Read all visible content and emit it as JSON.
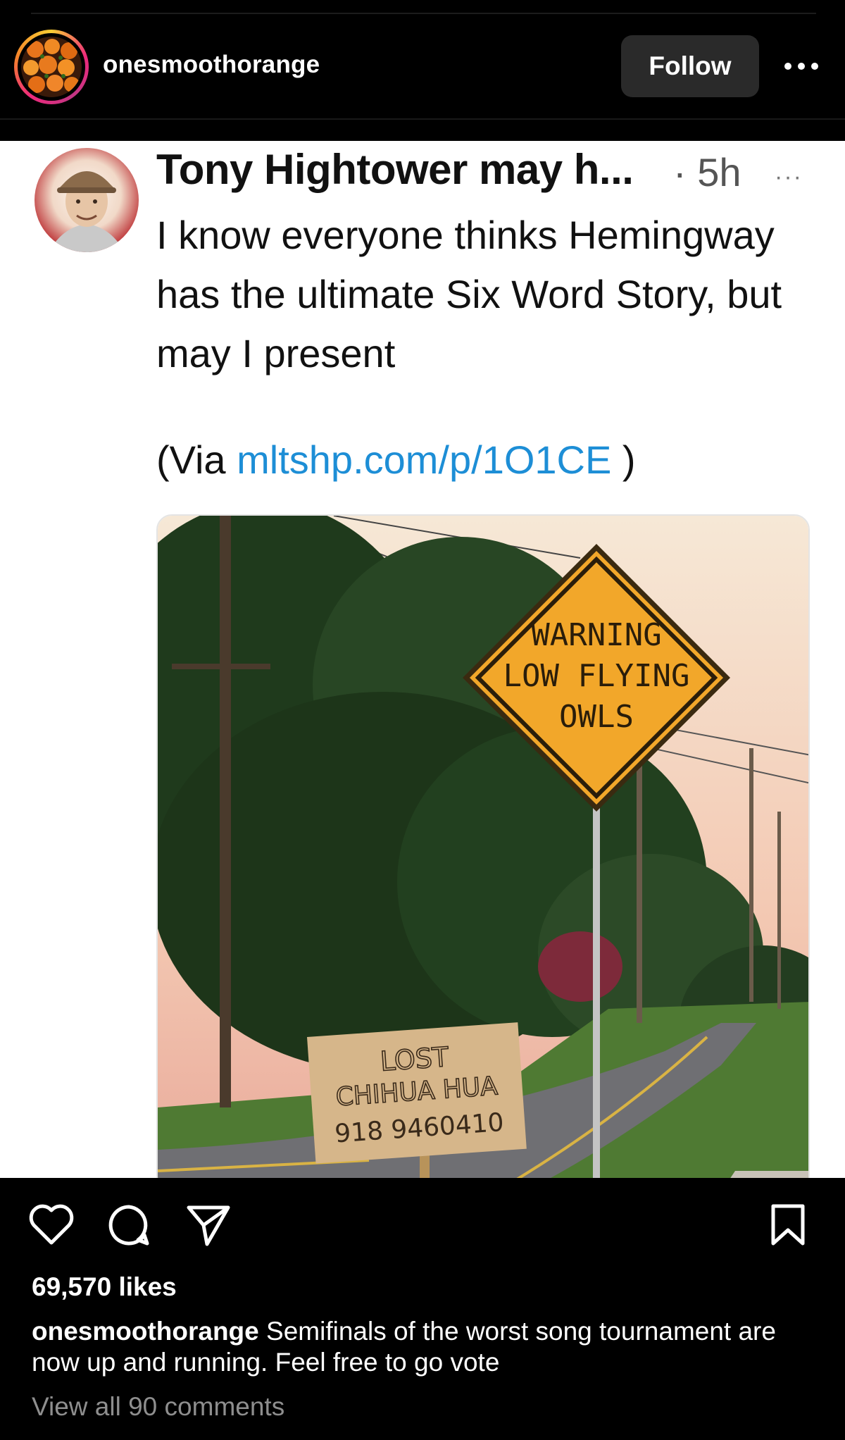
{
  "header": {
    "username": "onesmoothorange",
    "follow_label": "Follow",
    "more_label": "..."
  },
  "post": {
    "tweet": {
      "author": "Tony Hightower may h...",
      "time": "· 5h",
      "more": "···",
      "body": "I know everyone thinks Hemingway has the ultimate Six Word Story, but may I present",
      "via_prefix": "(Via ",
      "via_link": "mltshp.com/p/1O1CE",
      "via_suffix": " )"
    },
    "photo": {
      "sign_line1": "WARNING",
      "sign_line2": "LOW FLYING",
      "sign_line3": "OWLS",
      "cardboard_line1": "LOST",
      "cardboard_line2": "CHIHUA HUA",
      "cardboard_line3": "918 9460410"
    }
  },
  "actions": {
    "icons": [
      "heart-icon",
      "comment-icon",
      "share-icon",
      "bookmark-icon"
    ]
  },
  "likes": "69,570 likes",
  "caption": {
    "username": "onesmoothorange",
    "text": "Semifinals of the worst song tournament are now up and running. Feel free to go vote"
  },
  "comments_link": "View all 90 comments",
  "colors": {
    "link": "#1d8ed6",
    "follow_bg": "#2a2a2a",
    "muted": "#8e8e8e"
  }
}
